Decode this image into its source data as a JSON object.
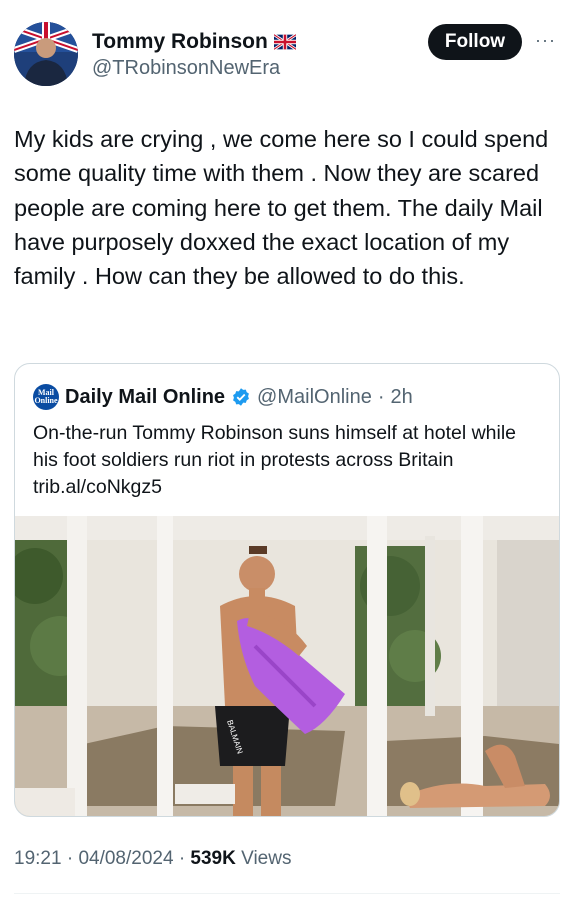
{
  "author": {
    "display_name": "Tommy Robinson",
    "flag_icon": "uk-flag-icon",
    "handle": "@TRobinsonNewEra",
    "avatar_icon": "avatar-photo"
  },
  "actions": {
    "follow_label": "Follow",
    "more_icon": "more-horizontal-icon",
    "more_glyph": "···"
  },
  "tweet": {
    "text": "My kids are crying , we come here so I could spend some quality time with them . Now they are scared people are coming here to get them. The daily Mail have purposely doxxed the exact location of my family . How can they be allowed to do this."
  },
  "quoted": {
    "logo_line1": "Mail",
    "logo_line2": "Online",
    "display_name": "Daily Mail Online",
    "verified_icon": "verified-badge-icon",
    "handle": "@MailOnline",
    "separator": "·",
    "age": "2h",
    "text": "On-the-run Tommy Robinson suns himself at hotel while his foot soldiers run riot in protests across Britain trib.al/coNkgz5",
    "shorts_text": "BALMAIN"
  },
  "meta": {
    "time": "19:21",
    "sep1": "·",
    "date": "04/08/2024",
    "sep2": "·",
    "views_count": "539K",
    "views_label": "Views"
  },
  "colors": {
    "text": "#0f1419",
    "secondary": "#536471",
    "border": "#cfd9de",
    "verified": "#1d9bf0",
    "towel": "#b35ee0"
  }
}
